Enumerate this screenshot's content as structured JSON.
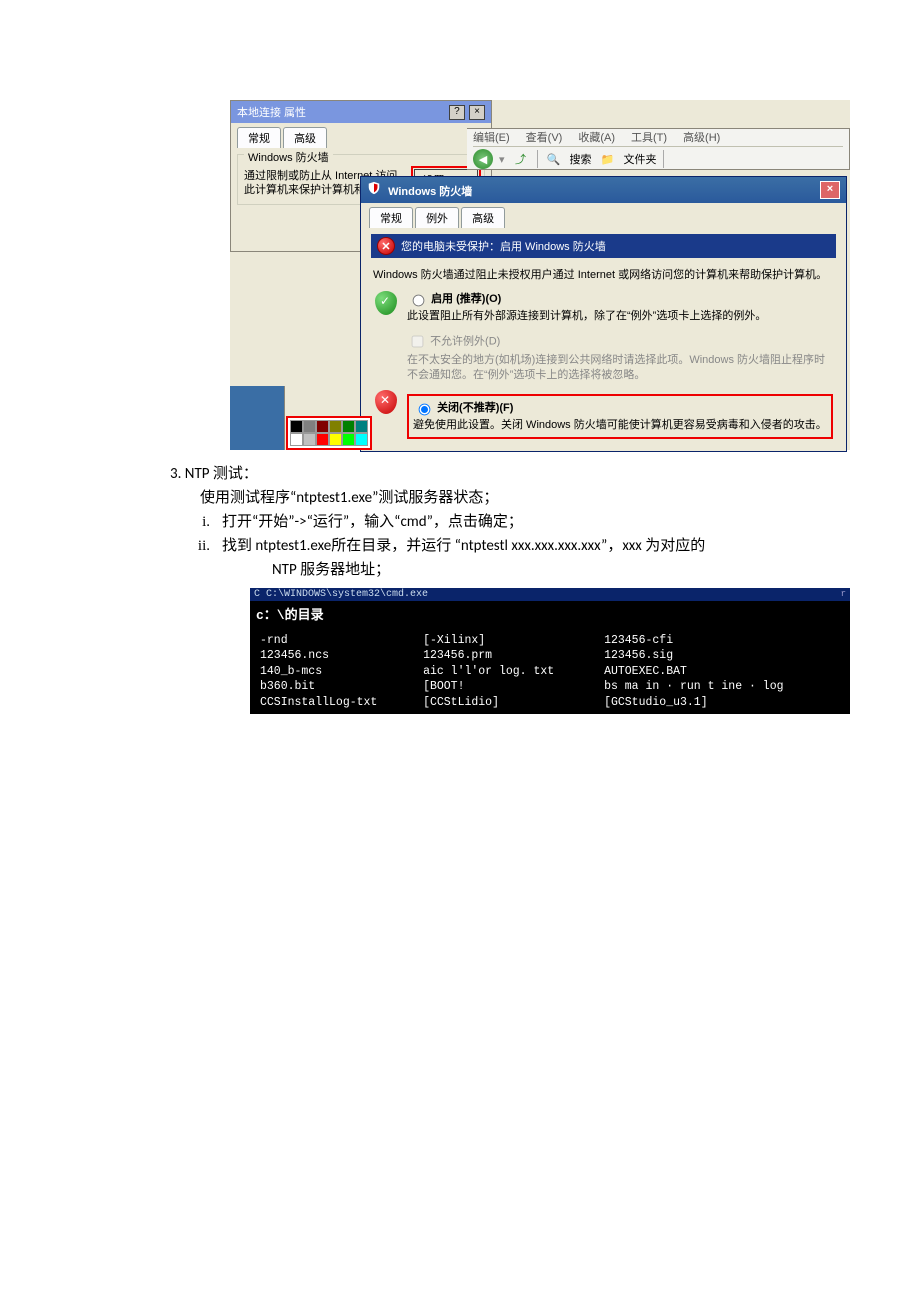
{
  "screenshot1": {
    "local_conn": {
      "title": "本地连接 属性",
      "help": "?",
      "close": "×",
      "tabs": {
        "tab1": "常规",
        "tab2": "高级"
      },
      "group_title": "Windows 防火墙",
      "desc": "通过限制或防止从 Internet 访问此计算机来保护计算机和网络",
      "settings_btn": "设置(N)..."
    },
    "explorer": {
      "menu_edit": "编辑(E)",
      "menu_view": "查看(V)",
      "menu_fav": "收藏(A)",
      "menu_tools": "工具(T)",
      "menu_adv": "高级(H)",
      "back_icon": "◀",
      "fwd_icon": "▶",
      "up_icon": "⤴",
      "search_label": "搜索",
      "folders_label": "文件夹"
    },
    "firewall": {
      "title": "Windows 防火墙",
      "tabs": {
        "tab1": "常规",
        "tab2": "例外",
        "tab3": "高级"
      },
      "alert": "您的电脑未受保护：启用 Windows 防火墙",
      "intro": "Windows 防火墙通过阻止未授权用户通过 Internet 或网络访问您的计算机来帮助保护计算机。",
      "opt_on_head": "启用 (推荐)(O)",
      "opt_on_desc": "此设置阻止所有外部源连接到计算机，除了在“例外”选项卡上选择的例外。",
      "opt_noexc_head": "不允许例外(D)",
      "opt_noexc_desc": "在不太安全的地方(如机场)连接到公共网络时请选择此项。Windows 防火墙阻止程序时不会通知您。在“例外”选项卡上的选择将被忽略。",
      "opt_off_head": "关闭(不推荐)(F)",
      "opt_off_desc": "避免使用此设置。关闭 Windows 防火墙可能使计算机更容易受病毒和入侵者的攻击。"
    },
    "palette_colors": [
      [
        "#000000",
        "#808080",
        "#800000",
        "#808000",
        "#008000",
        "#008080"
      ],
      [
        "#ffffff",
        "#c0c0c0",
        "#ff0000",
        "#ffff00",
        "#00ff00",
        "#00ffff"
      ]
    ]
  },
  "text": {
    "line_num": "3. NTP 测试：",
    "line_intro": "使用测试程序“ntptest1.exe”测试服务器状态；",
    "i_marker": "i.",
    "i_text": "打开“开始”->“运行”，输入“cmd”，点击确定；",
    "ii_marker": "ii.",
    "ii_text1": "找到  ntptest1.exe所在目录，并运行   “ntptestl xxx.xxx.xxx.xxx”，xxx 为对应的",
    "ii_text2": "NTP 服务器地址；"
  },
  "cmd": {
    "title": "C C:\\WINDOWS\\system32\\cmd.exe",
    "r": "r",
    "header": "c：\\的目录",
    "rows": [
      {
        "c1": "-rnd",
        "c2": "[-Xilinx]",
        "c3": "123456-cfi"
      },
      {
        "c1": "123456.ncs",
        "c2": "123456.prm",
        "c3": "123456.sig"
      },
      {
        "c1": "140_b-mcs",
        "c2": "aic l'l'or log. txt",
        "c3": "AUTOEXEC.BAT"
      },
      {
        "c1": "b360.bit",
        "c2": "[BOOT!",
        "c3": "bs ma in · run t ine · log"
      },
      {
        "c1": "CCSInstallLog-txt",
        "c2": "[CCStLidio]",
        "c3": "[GCStudio_u3.1]"
      }
    ]
  }
}
